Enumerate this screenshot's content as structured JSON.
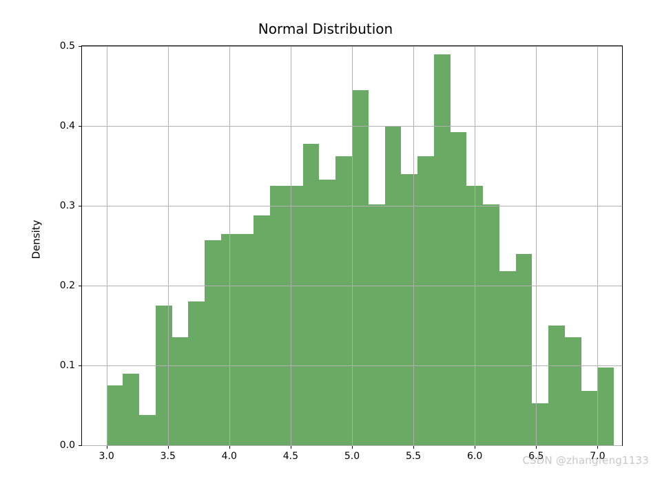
{
  "chart_data": {
    "type": "bar",
    "title": "Normal Distribution",
    "xlabel": "",
    "ylabel": "Density",
    "xlim": [
      2.8,
      7.2
    ],
    "ylim": [
      0.0,
      0.5
    ],
    "bar_color": "#6aaa64",
    "x_ticks": [
      3.0,
      3.5,
      4.0,
      4.5,
      5.0,
      5.5,
      6.0,
      6.5,
      7.0
    ],
    "y_ticks": [
      0.0,
      0.1,
      0.2,
      0.3,
      0.4,
      0.5
    ],
    "bin_edges": [
      3.0,
      3.133,
      3.267,
      3.4,
      3.533,
      3.667,
      3.8,
      3.933,
      4.067,
      4.2,
      4.333,
      4.467,
      4.6,
      4.733,
      4.867,
      5.0,
      5.133,
      5.267,
      5.4,
      5.533,
      5.667,
      5.8,
      5.933,
      6.067,
      6.2,
      6.333,
      6.467,
      6.6,
      6.733,
      6.867,
      7.0
    ],
    "values": [
      0.075,
      0.09,
      0.038,
      0.175,
      0.135,
      0.18,
      0.257,
      0.265,
      0.265,
      0.288,
      0.325,
      0.325,
      0.378,
      0.333,
      0.362,
      0.445,
      0.302,
      0.4,
      0.34,
      0.362,
      0.49,
      0.392,
      0.325,
      0.302,
      0.218,
      0.24,
      0.053,
      0.15,
      0.135,
      0.068,
      0.097
    ]
  },
  "watermark": "CSDN @zhangfeng1133"
}
